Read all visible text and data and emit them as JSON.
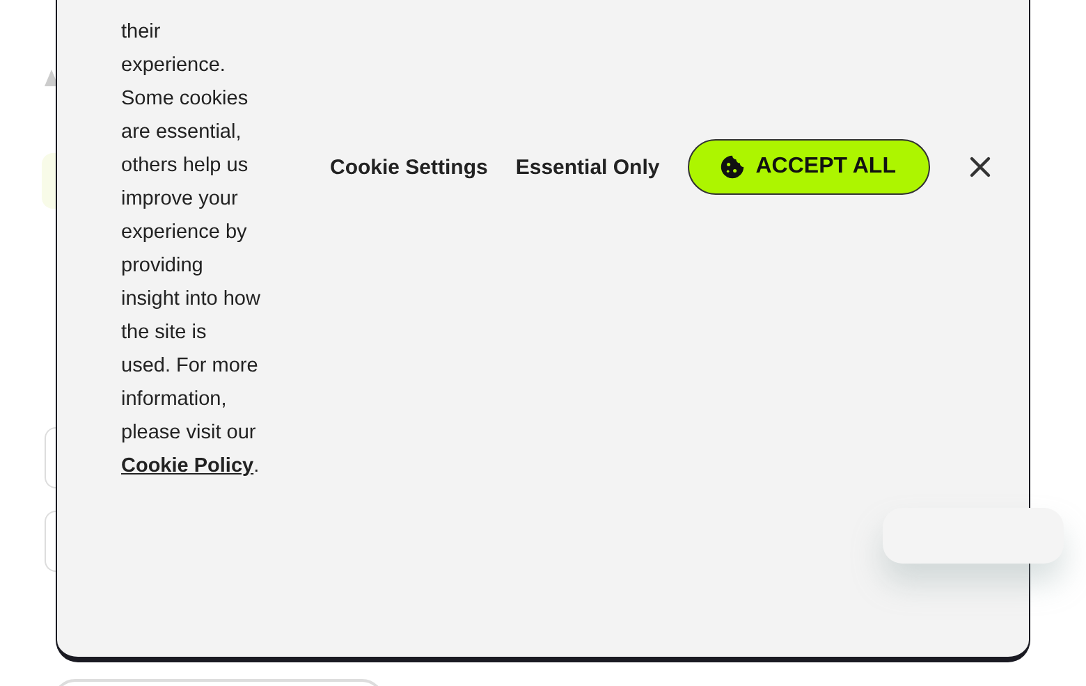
{
  "cookie_banner": {
    "message": "their experience. Some cookies are essential, others help us improve your experience by providing insight into how the site is used. For more information, please visit our",
    "link": "Cookie Policy",
    "message_end": ".",
    "buttons": [
      {
        "kind": "text",
        "label": "Cookie Settings"
      },
      {
        "kind": "text",
        "label": "Essential Only"
      },
      {
        "kind": "primary",
        "label": "ACCEPT ALL"
      }
    ]
  }
}
